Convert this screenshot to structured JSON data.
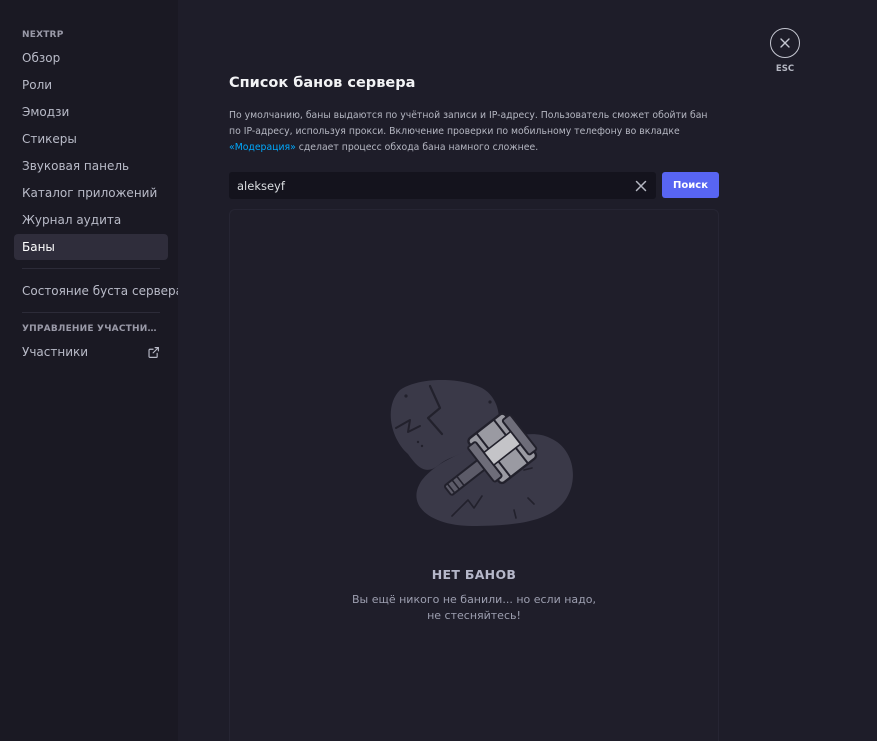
{
  "sidebar": {
    "server_header": "NEXTRP",
    "items": [
      {
        "label": "Обзор"
      },
      {
        "label": "Роли"
      },
      {
        "label": "Эмодзи"
      },
      {
        "label": "Стикеры"
      },
      {
        "label": "Звуковая панель"
      },
      {
        "label": "Каталог приложений"
      },
      {
        "label": "Журнал аудита"
      },
      {
        "label": "Баны",
        "active": true
      }
    ],
    "boost_item": "Состояние буста сервера",
    "members_header": "УПРАВЛЕНИЕ УЧАСТНИКА...",
    "members_item": "Участники",
    "members_item_icon": "external-link-icon"
  },
  "main": {
    "title": "Список банов сервера",
    "description_before": "По умолчанию, баны выдаются по учётной записи и IP-адресу. Пользователь сможет обойти бан по IP-адресу, используя прокси. Включение проверки по мобильному телефону во вкладке ",
    "description_link": "«Модерация»",
    "description_after": " сделает процесс обхода бана намного сложнее.",
    "search": {
      "value": "alekseyf",
      "clear_icon": "close-icon",
      "button_label": "Поиск"
    },
    "empty_state": {
      "illustration": "ban-hammer-illustration",
      "title": "НЕТ БАНОВ",
      "line1": "Вы ещё никого не банили... но если надо,",
      "line2": "не стесняйтесь!"
    }
  },
  "close": {
    "icon": "close-icon",
    "label": "ESC"
  },
  "colors": {
    "accent": "#5865f2",
    "link": "#00a8fc",
    "sidebar_bg": "#1a1923",
    "main_bg": "#1e1d29"
  }
}
